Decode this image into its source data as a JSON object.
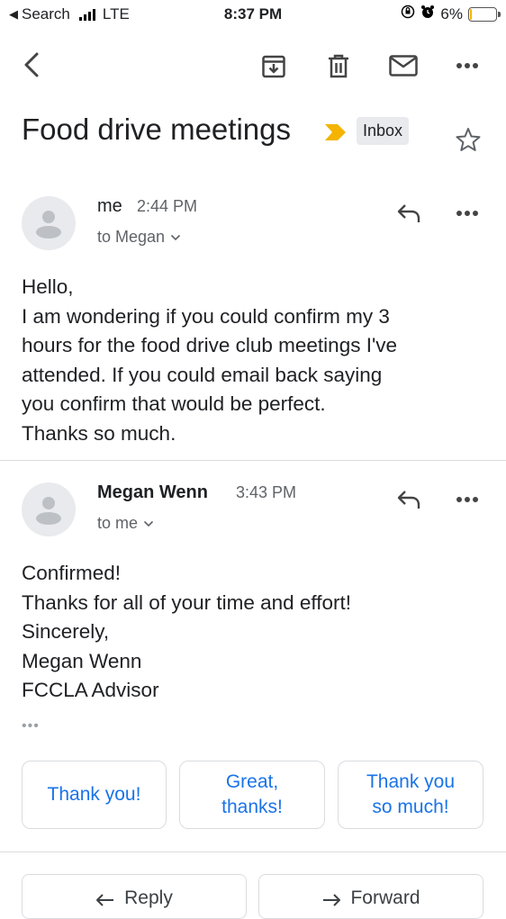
{
  "status_bar": {
    "back_app": "Search",
    "network": "LTE",
    "time": "8:37 PM",
    "battery_percent": "6%",
    "battery_level": 0.06
  },
  "thread": {
    "subject": "Food drive meetings",
    "label": "Inbox"
  },
  "messages": [
    {
      "sender": "me",
      "time": "2:44 PM",
      "recipients": "to Megan",
      "body": "Hello,\nI am wondering if you could confirm my 3\nhours for the food drive club meetings I've\nattended. If you could email back saying\nyou confirm that would be perfect.\nThanks so much."
    },
    {
      "sender": "Megan Wenn",
      "time": "3:43 PM",
      "recipients": "to me",
      "body": "Confirmed!\nThanks for all of your time and effort!\nSincerely,\nMegan Wenn\nFCCLA Advisor",
      "trimmed": "•••"
    }
  ],
  "smart_replies": [
    "Thank you!",
    "Great,\nthanks!",
    "Thank you\nso much!"
  ],
  "actions": {
    "reply": "Reply",
    "forward": "Forward"
  },
  "colors": {
    "accent": "#1a73e8",
    "important_marker": "#f4b400"
  }
}
